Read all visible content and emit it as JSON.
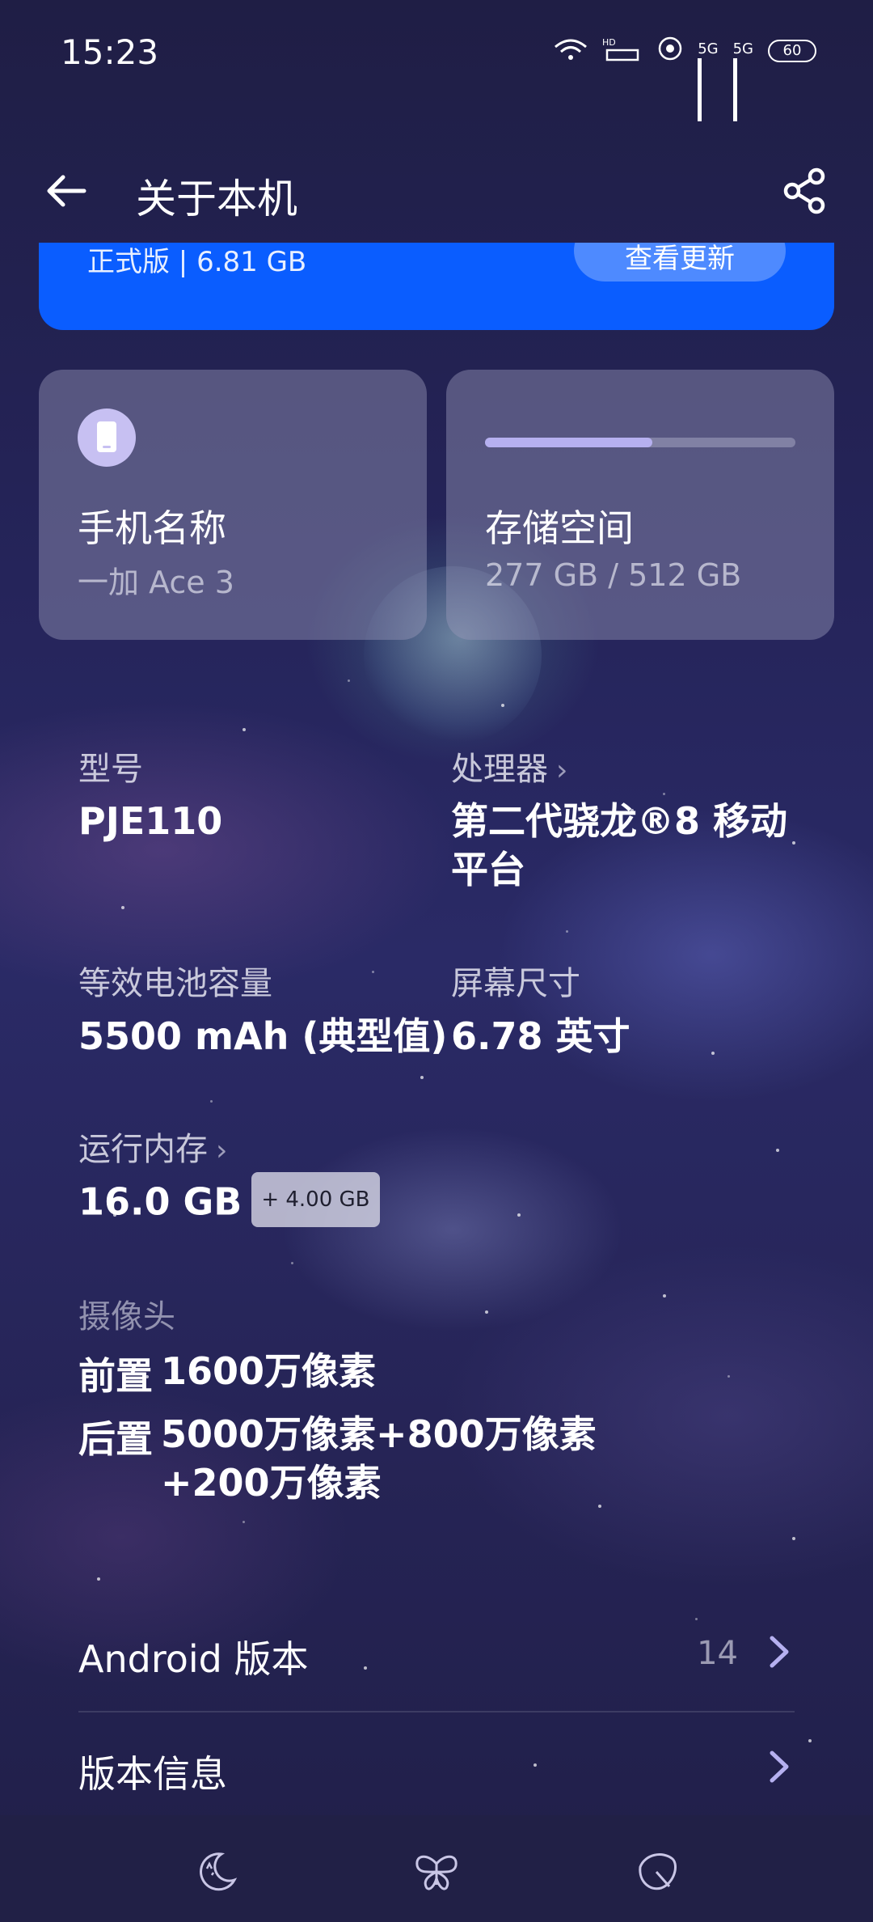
{
  "status_bar": {
    "time": "15:23",
    "network_1": "5G",
    "network_2": "5G",
    "battery": "60"
  },
  "app_bar": {
    "title": "关于本机"
  },
  "update_card": {
    "version_text": "正式版 | 6.81 GB",
    "button_label": "查看更新"
  },
  "phone_name_card": {
    "title": "手机名称",
    "value": "一加 Ace 3"
  },
  "storage_card": {
    "title": "存储空间",
    "value": "277 GB / 512 GB",
    "used_fraction": 0.54
  },
  "specs": {
    "model": {
      "label": "型号",
      "value": "PJE110"
    },
    "processor": {
      "label": "处理器",
      "value": "第二代骁龙®8 移动平台"
    },
    "battery": {
      "label": "等效电池容量",
      "value": "5500 mAh (典型值)"
    },
    "screen": {
      "label": "屏幕尺寸",
      "value": "6.78 英寸"
    },
    "ram": {
      "label": "运行内存",
      "value": "16.0 GB",
      "badge": "+ 4.00 GB"
    }
  },
  "camera": {
    "label": "摄像头",
    "front_key": "前置",
    "front_value": "1600万像素",
    "rear_key": "后置",
    "rear_value": "5000万像素+800万像素+200万像素"
  },
  "rows": {
    "android": {
      "label": "Android 版本",
      "value": "14"
    },
    "version_info": {
      "label": "版本信息"
    }
  },
  "colors": {
    "accent_blue": "#0a5dff",
    "background": "#1f1e45",
    "storage_fill": "#b6b0f0"
  },
  "icons": {
    "back": "arrow-left-icon",
    "share": "share-icon",
    "phone": "phone-icon",
    "tab1": "moon-icon",
    "tab2": "butterfly-icon",
    "tab3": "leaf-icon"
  }
}
